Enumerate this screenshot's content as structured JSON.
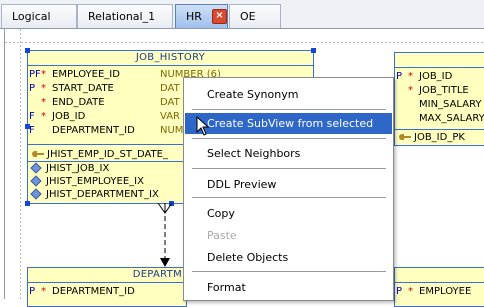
{
  "tabs": [
    {
      "label": "Logical"
    },
    {
      "label": "Relational_1"
    },
    {
      "label": "HR",
      "close": "×"
    },
    {
      "label": "OE"
    }
  ],
  "job_history": {
    "title": "JOB_HISTORY",
    "columns": [
      {
        "key": "PF",
        "req": "*",
        "name": "EMPLOYEE_ID",
        "type": "NUMBER (6)"
      },
      {
        "key": "P",
        "req": "*",
        "name": "START_DATE",
        "type": "DAT"
      },
      {
        "key": "",
        "req": "*",
        "name": "END_DATE",
        "type": "DAT"
      },
      {
        "key": "F",
        "req": "*",
        "name": "JOB_ID",
        "type": "VAR"
      },
      {
        "key": "F",
        "req": "",
        "name": "DEPARTMENT_ID",
        "type": "NUM"
      }
    ],
    "pk": "JHIST_EMP_ID_ST_DATE_",
    "indexes": [
      "JHIST_JOB_IX",
      "JHIST_EMPLOYEE_IX",
      "JHIST_DEPARTMENT_IX"
    ]
  },
  "jobs": {
    "columns": [
      {
        "key": "P",
        "req": "*",
        "name": "JOB_ID"
      },
      {
        "key": "",
        "req": "*",
        "name": "JOB_TITLE"
      },
      {
        "key": "",
        "req": "",
        "name": "MIN_SALARY"
      },
      {
        "key": "",
        "req": "",
        "name": "MAX_SALARY"
      }
    ],
    "pk": "JOB_ID_PK"
  },
  "departments": {
    "title": "DEPARTM",
    "columns": [
      {
        "key": "P",
        "req": "*",
        "name": "DEPARTMENT_ID"
      }
    ]
  },
  "employees": {
    "columns": [
      {
        "key": "P",
        "req": "*",
        "name": "EMPLOYEE"
      }
    ]
  },
  "menu": {
    "items": [
      {
        "label": "Create Synonym"
      },
      {
        "label": "Create SubView from selected"
      },
      {
        "label": "Select Neighbors"
      },
      {
        "label": "DDL Preview"
      },
      {
        "label": "Copy"
      },
      {
        "label": "Paste"
      },
      {
        "label": "Delete Objects"
      },
      {
        "label": "Format"
      }
    ]
  }
}
